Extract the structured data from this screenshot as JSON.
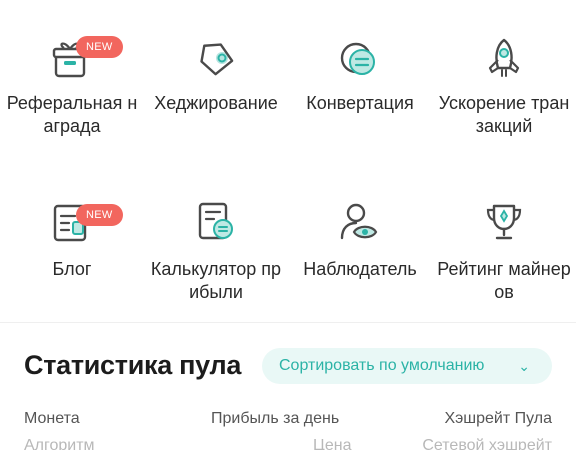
{
  "menu": {
    "items": [
      {
        "label": "Реферальная награда",
        "icon": "gift-icon",
        "badge": "NEW"
      },
      {
        "label": "Хеджирование",
        "icon": "tag-icon",
        "badge": ""
      },
      {
        "label": "Конвертация",
        "icon": "convert-icon",
        "badge": ""
      },
      {
        "label": "Ускорение транзакций",
        "icon": "rocket-icon",
        "badge": ""
      },
      {
        "label": "Блог",
        "icon": "blog-icon",
        "badge": "NEW"
      },
      {
        "label": "Калькулятор прибыли",
        "icon": "calculator-icon",
        "badge": ""
      },
      {
        "label": "Наблюдатель",
        "icon": "observer-icon",
        "badge": ""
      },
      {
        "label": "Рейтинг майнеров",
        "icon": "trophy-icon",
        "badge": ""
      }
    ]
  },
  "pool": {
    "title": "Статистика пула",
    "sort_label": "Сортировать по умолчанию",
    "columns": {
      "coin": "Монета",
      "profit": "Прибыль за день",
      "hashrate": "Хэшрейт Пула",
      "algorithm": "Алгоритм",
      "price": "Цена",
      "network_hashrate": "Сетевой хэшрейт"
    }
  },
  "colors": {
    "accent": "#2bb3a6",
    "icon_stroke": "#4a4a4a",
    "badge": "#f2665e"
  }
}
